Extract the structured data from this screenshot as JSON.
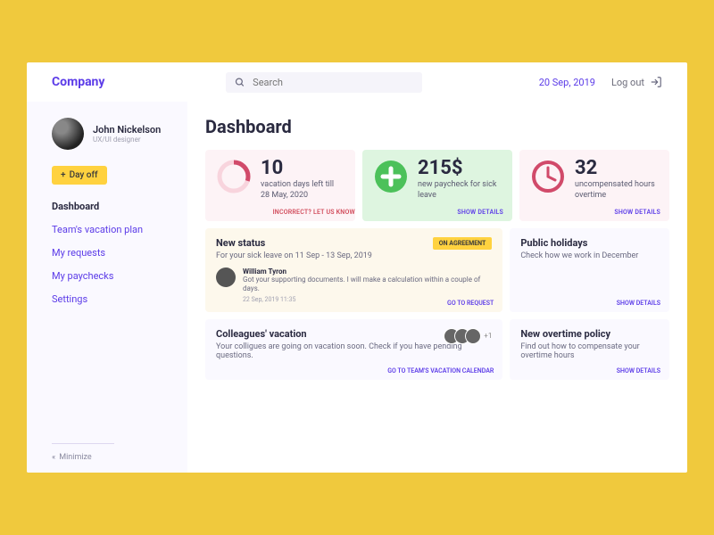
{
  "brand": "Company",
  "search_placeholder": "Search",
  "date": "20 Sep, 2019",
  "logout_label": "Log out",
  "user": {
    "name": "John Nickelson",
    "role": "UX/UI designer"
  },
  "dayoff_label": "Day off",
  "nav": {
    "dashboard": "Dashboard",
    "team_vacation": "Team's vacation plan",
    "my_requests": "My requests",
    "my_paychecks": "My paychecks",
    "settings": "Settings"
  },
  "minimize_label": "Minimize",
  "page_title": "Dashboard",
  "stats": {
    "vacation": {
      "value": "10",
      "label": "vacation days left\ntill 28 May, 2020",
      "link": "INCORRECT? LET US KNOW"
    },
    "paycheck": {
      "value": "215$",
      "label": "new paycheck\nfor sick leave",
      "link": "SHOW DETAILS"
    },
    "overtime": {
      "value": "32",
      "label": "uncompensated\nhours overtime",
      "link": "SHOW DETAILS"
    }
  },
  "status": {
    "title": "New status",
    "sub": "For your sick leave on 11 Sep - 13 Sep, 2019",
    "badge": "ON AGREEMENT",
    "comment": {
      "name": "William Tyron",
      "text": "Got your supporting documents. I will make a calculation within a couple of days.",
      "time": "22 Sep, 2019    11:35"
    },
    "link": "GO TO REQUEST"
  },
  "holidays": {
    "title": "Public holidays",
    "sub": "Check how we work in December",
    "link": "SHOW DETAILS"
  },
  "colleagues": {
    "title": "Colleagues' vacation",
    "sub": "Your colligues are going on vacation soon. Check if you have pending questions.",
    "more": "+1",
    "link": "GO TO TEAM'S VACATION CALENDAR"
  },
  "policy": {
    "title": "New overtime policy",
    "sub": "Find out how to compensate your overtime hours",
    "link": "SHOW DETAILS"
  }
}
